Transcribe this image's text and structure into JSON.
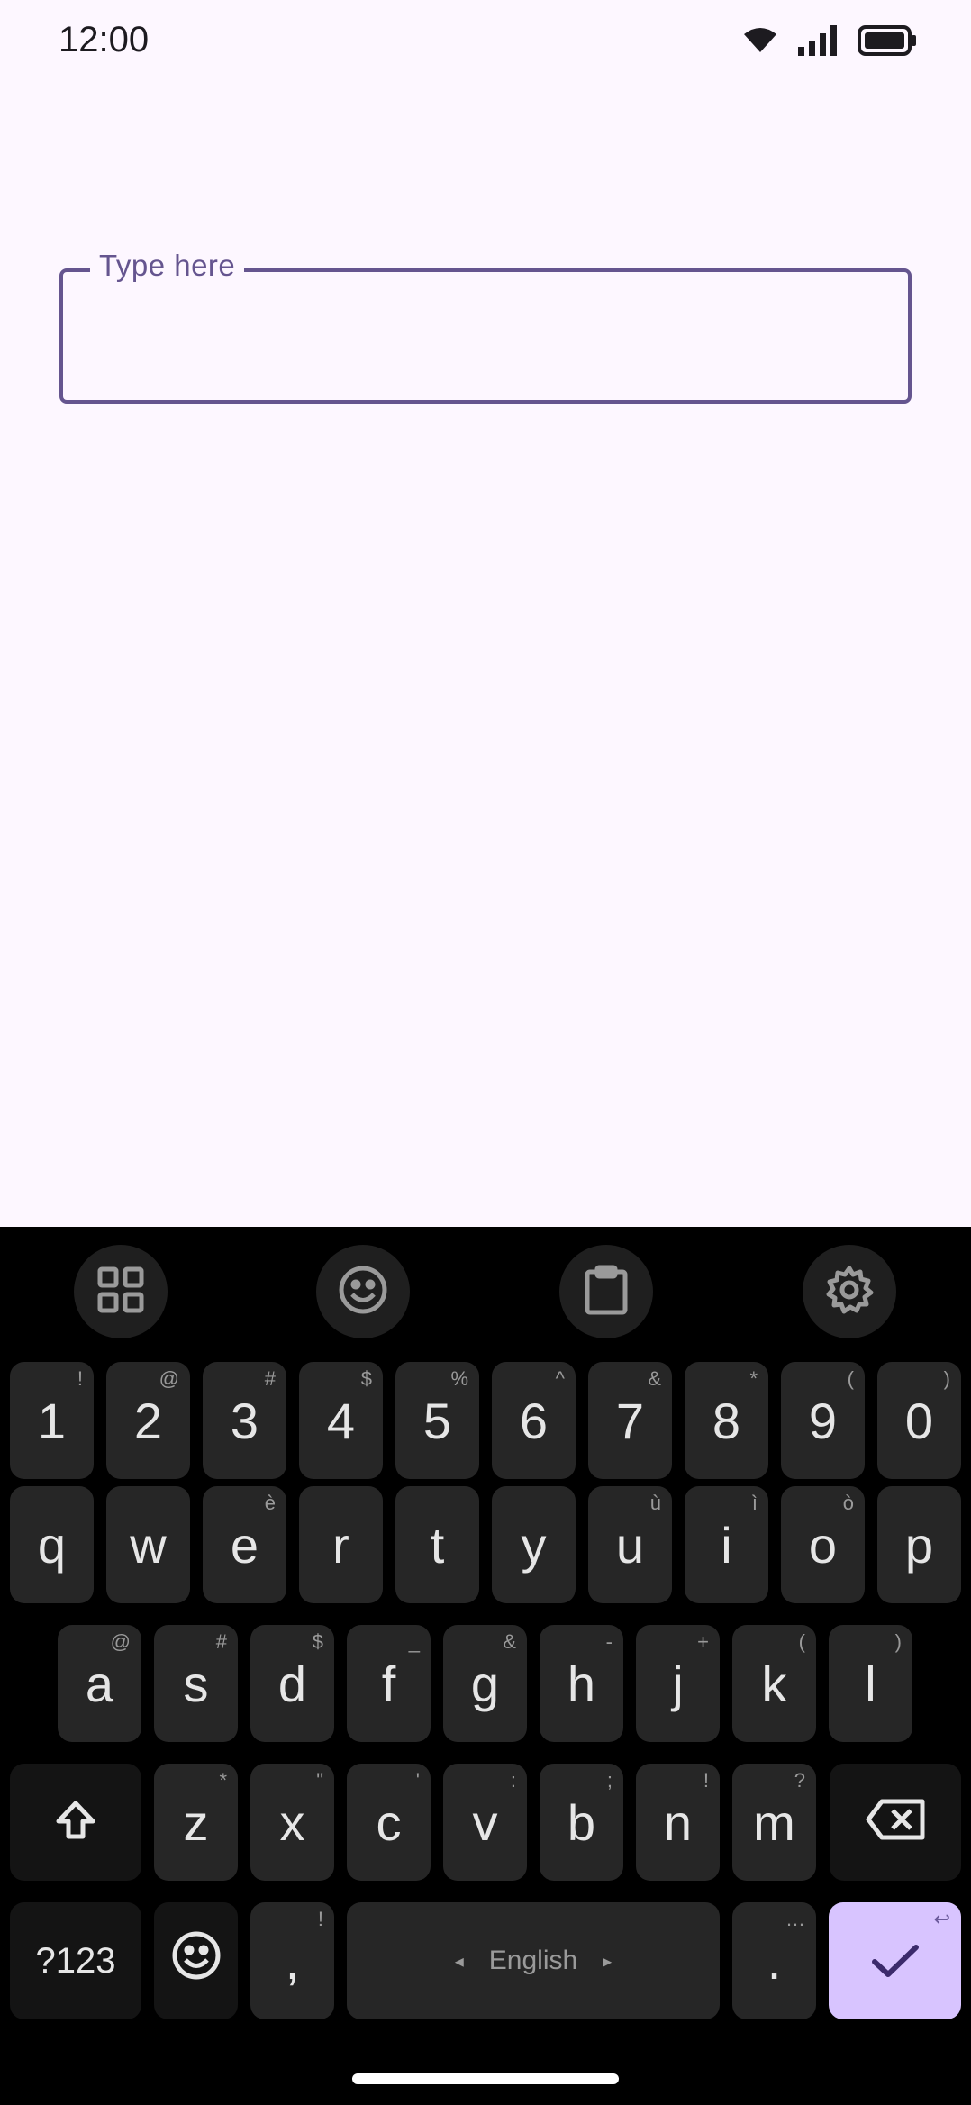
{
  "status_bar": {
    "time": "12:00"
  },
  "field": {
    "label": "Type here",
    "value": ""
  },
  "keyboard": {
    "number_row": [
      {
        "key": "1",
        "hint": "!"
      },
      {
        "key": "2",
        "hint": "@"
      },
      {
        "key": "3",
        "hint": "#"
      },
      {
        "key": "4",
        "hint": "$"
      },
      {
        "key": "5",
        "hint": "%"
      },
      {
        "key": "6",
        "hint": "^"
      },
      {
        "key": "7",
        "hint": "&"
      },
      {
        "key": "8",
        "hint": "*"
      },
      {
        "key": "9",
        "hint": "("
      },
      {
        "key": "0",
        "hint": ")"
      }
    ],
    "row1": [
      {
        "key": "q",
        "hint": ""
      },
      {
        "key": "w",
        "hint": ""
      },
      {
        "key": "e",
        "hint": "è"
      },
      {
        "key": "r",
        "hint": ""
      },
      {
        "key": "t",
        "hint": ""
      },
      {
        "key": "y",
        "hint": ""
      },
      {
        "key": "u",
        "hint": "ù"
      },
      {
        "key": "i",
        "hint": "ì"
      },
      {
        "key": "o",
        "hint": "ò"
      },
      {
        "key": "p",
        "hint": ""
      }
    ],
    "row2": [
      {
        "key": "a",
        "hint": "@"
      },
      {
        "key": "s",
        "hint": "#"
      },
      {
        "key": "d",
        "hint": "$"
      },
      {
        "key": "f",
        "hint": "_"
      },
      {
        "key": "g",
        "hint": "&"
      },
      {
        "key": "h",
        "hint": "-"
      },
      {
        "key": "j",
        "hint": "+"
      },
      {
        "key": "k",
        "hint": "("
      },
      {
        "key": "l",
        "hint": ")"
      }
    ],
    "row3": [
      {
        "key": "z",
        "hint": "*"
      },
      {
        "key": "x",
        "hint": "\""
      },
      {
        "key": "c",
        "hint": "'"
      },
      {
        "key": "v",
        "hint": ":"
      },
      {
        "key": "b",
        "hint": ";"
      },
      {
        "key": "n",
        "hint": "!"
      },
      {
        "key": "m",
        "hint": "?"
      }
    ],
    "bottom": {
      "symbols_label": "?123",
      "comma": ",",
      "comma_hint": "!",
      "space_label": "English",
      "space_left_arrow": "◂",
      "space_right_arrow": "▸",
      "period": ".",
      "period_hint": "…",
      "enter_hint": "↩"
    },
    "accent_color": "#d8c4ff",
    "toolbar_icons": [
      "apps-grid-icon",
      "emoji-icon",
      "clipboard-icon",
      "settings-gear-icon"
    ]
  }
}
